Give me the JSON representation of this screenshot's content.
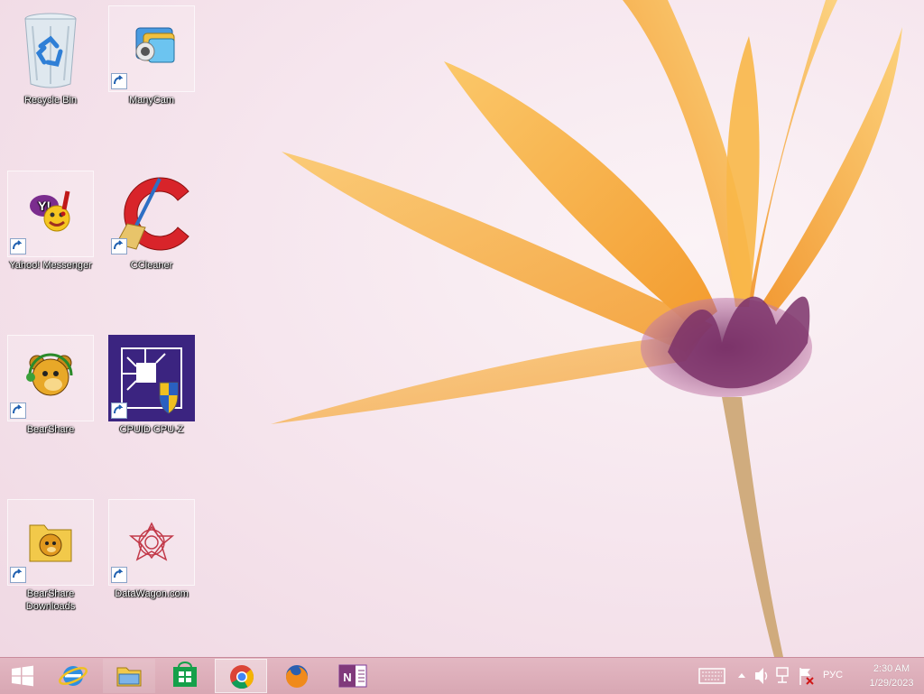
{
  "desktop": {
    "icons": [
      {
        "label": "Recycle Bin",
        "icon": "recycle-bin-icon"
      },
      {
        "label": "ManyCam",
        "icon": "manycam-icon"
      },
      {
        "label": "Yahoo! Messenger",
        "icon": "yahoo-messenger-icon"
      },
      {
        "label": "CCleaner",
        "icon": "ccleaner-icon"
      },
      {
        "label": "BearShare",
        "icon": "bearshare-icon"
      },
      {
        "label": "CPUID CPU-Z",
        "icon": "cpu-z-icon"
      },
      {
        "label": "BearShare Downloads",
        "icon": "folder-bearshare-icon"
      },
      {
        "label": "DataWagon.com",
        "icon": "datawagon-icon"
      }
    ]
  },
  "taskbar": {
    "buttons": [
      {
        "name": "start",
        "icon": "windows-start-icon"
      },
      {
        "name": "internet-explorer",
        "icon": "internet-explorer-icon"
      },
      {
        "name": "file-explorer",
        "icon": "file-explorer-icon"
      },
      {
        "name": "store",
        "icon": "windows-store-icon"
      },
      {
        "name": "chrome",
        "icon": "chrome-icon"
      },
      {
        "name": "firefox",
        "icon": "firefox-icon"
      },
      {
        "name": "onenote",
        "icon": "onenote-icon"
      }
    ],
    "tray": {
      "language": "РУС",
      "time": "2:30 AM",
      "date": "1/29/2023",
      "icons": [
        "touch-keyboard-icon",
        "show-hidden-icons-chevron",
        "volume-icon",
        "network-icon",
        "action-center-flag-icon"
      ]
    }
  },
  "colors": {
    "wallpaper_bg": "#f6e6ee",
    "petal": "#f7ad3c",
    "flower_center": "#8a3d74",
    "taskbar": "#dcadb9"
  }
}
